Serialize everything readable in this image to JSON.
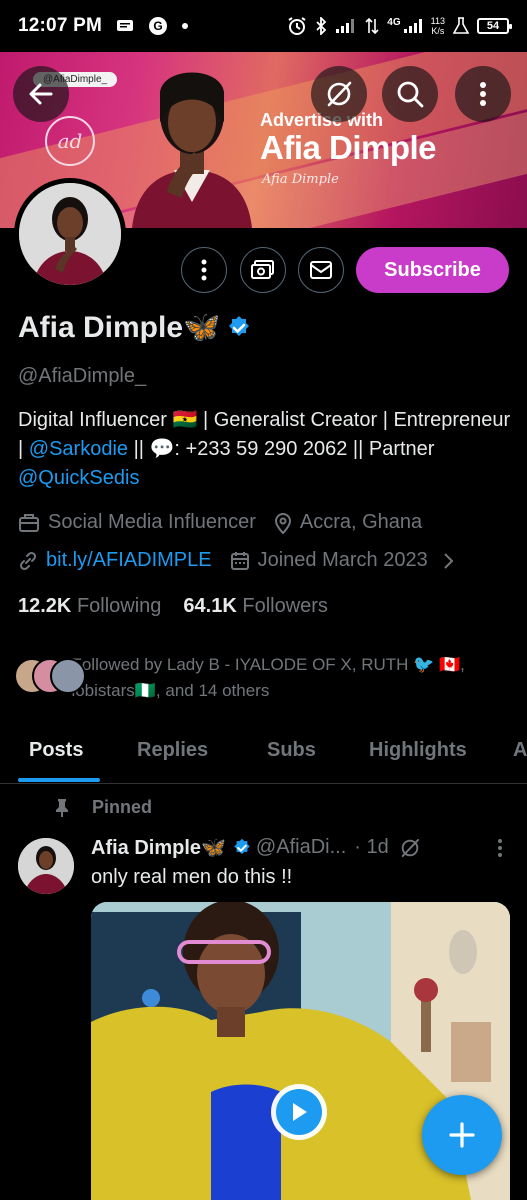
{
  "status_bar": {
    "time": "12:07 PM",
    "network_speed_value": "113",
    "network_speed_unit": "K/s",
    "network_type": "4G",
    "battery": "54"
  },
  "banner": {
    "handle_tag": "@AfiaDimple_",
    "logo_text": "ad",
    "headline_small": "Advertise with",
    "headline_large": "Afia Dimple",
    "signature": "Afia Dimple"
  },
  "top_actions": {
    "back_icon": "arrow-left-icon",
    "grok_icon": "grok-icon",
    "search_icon": "search-icon",
    "more_icon": "more-vertical-icon"
  },
  "profile": {
    "display_name": "Afia Dimple🦋",
    "handle": "@AfiaDimple_",
    "subscribe_label": "Subscribe",
    "bio_part1": "Digital Influencer 🇬🇭 | Generalist Creator | Entrepreneur | ",
    "bio_link1": "@Sarkodie",
    "bio_part2": " || 💬: +233 59 290 2062 || Partner ",
    "bio_link2": "@QuickSedis",
    "category": "Social Media Influencer",
    "location": "Accra, Ghana",
    "website": "bit.ly/AFIADIMPLE",
    "joined": "Joined March 2023",
    "following_count": "12.2K",
    "following_label": "Following",
    "followers_count": "64.1K",
    "followers_label": "Followers",
    "followed_by": "Followed by Lady B - IYALODE OF X, RUTH 🐦 🇨🇦, lobistars🇳🇬, and 14 others"
  },
  "tabs": [
    {
      "label": "Posts",
      "active": true
    },
    {
      "label": "Replies",
      "active": false
    },
    {
      "label": "Subs",
      "active": false
    },
    {
      "label": "Highlights",
      "active": false
    },
    {
      "label": "A",
      "active": false
    }
  ],
  "post": {
    "pinned_label": "Pinned",
    "author": "Afia Dimple🦋",
    "handle": "@AfiaDi...",
    "time": "· 1d",
    "text": "only real men do this !!"
  },
  "colors": {
    "accent": "#1d9bf0",
    "subscribe": "#c93bc9",
    "background": "#000000",
    "muted": "#71767b"
  }
}
